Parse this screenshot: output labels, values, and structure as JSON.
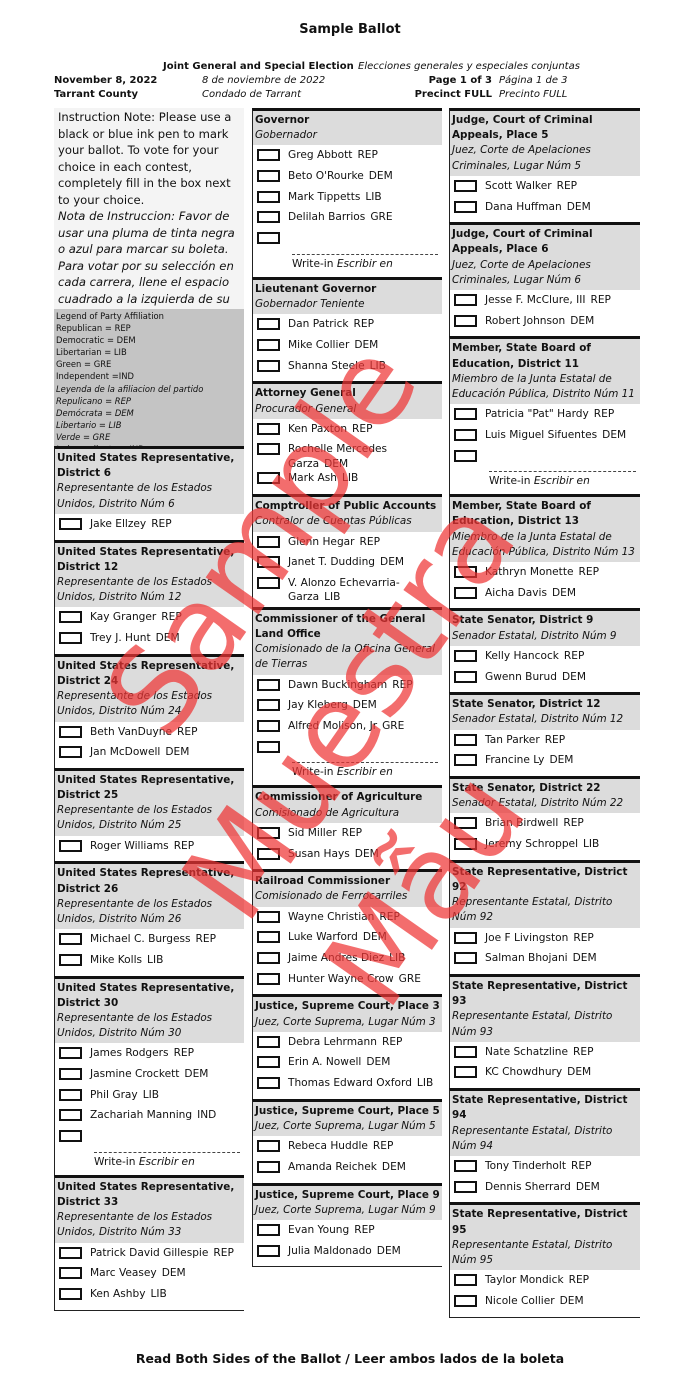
{
  "header": {
    "title": "Sample Ballot",
    "election_en": "Joint General and Special Election",
    "election_es": "Elecciones generales y especiales conjuntas",
    "date_en": "November 8, 2022",
    "date_es": "8 de noviembre de 2022",
    "county_en": "Tarrant County",
    "county_es": "Condado de Tarrant",
    "page_en": "Page 1 of 3",
    "page_es": "Página 1 de 3",
    "precinct_en": "Precinct FULL",
    "precinct_es": "Precinto FULL"
  },
  "instructions": {
    "en": "Instruction Note: Please use a black or blue ink pen to mark your ballot. To vote for your choice in each contest, completely fill in the box next to your choice.",
    "es": "Nota de Instruccion: Favor de usar una pluma de tinta negra o azul para marcar su boleta. Para votar por su selección en cada carrera, llene el espacio cuadrado a la izquierda de su selección."
  },
  "legend": {
    "en_title": "Legend of Party Affiliation",
    "en_items": [
      "Republican = REP",
      "Democratic = DEM",
      "Libertarian = LIB",
      "Green = GRE",
      "Independent =IND"
    ],
    "es_title": "Leyenda de la afiliacion del partido",
    "es_items": [
      "Repulicano = REP",
      "Demócrata = DEM",
      "Libertario = LIB",
      "Verde = GRE",
      "Independiente = IND"
    ]
  },
  "writein_label": {
    "en": "Write-in",
    "es": "Escribir en"
  },
  "columns": [
    [
      {
        "en": "United States Representative, District 6",
        "es": "Representante de los Estados Unidos, Distrito Núm 6",
        "candidates": [
          [
            "Jake Ellzey",
            "REP"
          ]
        ],
        "writein": false
      },
      {
        "en": "United States Representative, District 12",
        "es": "Representante de los Estados Unidos, Distrito Núm 12",
        "candidates": [
          [
            "Kay Granger",
            "REP"
          ],
          [
            "Trey J. Hunt",
            "DEM"
          ]
        ],
        "writein": false
      },
      {
        "en": "United States Representative, District 24",
        "es": "Representante de los Estados Unidos, Distrito Núm 24",
        "candidates": [
          [
            "Beth VanDuyne",
            "REP"
          ],
          [
            "Jan McDowell",
            "DEM"
          ]
        ],
        "writein": false
      },
      {
        "en": "United States Representative, District 25",
        "es": "Representante de los Estados Unidos, Distrito Núm 25",
        "candidates": [
          [
            "Roger Williams",
            "REP"
          ]
        ],
        "writein": false
      },
      {
        "en": "United States Representative, District 26",
        "es": "Representante de los Estados Unidos, Distrito Núm 26",
        "candidates": [
          [
            "Michael C. Burgess",
            "REP"
          ],
          [
            "Mike Kolls",
            "LIB"
          ]
        ],
        "writein": false
      },
      {
        "en": "United States Representative, District 30",
        "es": "Representante de los Estados Unidos, Distrito Núm 30",
        "candidates": [
          [
            "James Rodgers",
            "REP"
          ],
          [
            "Jasmine Crockett",
            "DEM"
          ],
          [
            "Phil Gray",
            "LIB"
          ],
          [
            "Zachariah Manning",
            "IND"
          ]
        ],
        "writein": true
      },
      {
        "en": "United States Representative, District 33",
        "es": "Representante de los Estados Unidos, Distrito Núm 33",
        "candidates": [
          [
            "Patrick David Gillespie",
            "REP"
          ],
          [
            "Marc Veasey",
            "DEM"
          ],
          [
            "Ken Ashby",
            "LIB"
          ]
        ],
        "writein": false
      }
    ],
    [
      {
        "en": "Governor",
        "es": "Gobernador",
        "candidates": [
          [
            "Greg Abbott",
            "REP"
          ],
          [
            "Beto O'Rourke",
            "DEM"
          ],
          [
            "Mark Tippetts",
            "LIB"
          ],
          [
            "Delilah Barrios",
            "GRE"
          ]
        ],
        "writein": true
      },
      {
        "en": "Lieutenant Governor",
        "es": "Gobernador Teniente",
        "candidates": [
          [
            "Dan Patrick",
            "REP"
          ],
          [
            "Mike Collier",
            "DEM"
          ],
          [
            "Shanna Steele",
            "LIB"
          ]
        ],
        "writein": false
      },
      {
        "en": "Attorney General",
        "es": "Procurador General",
        "candidates": [
          [
            "Ken Paxton",
            "REP"
          ],
          [
            "Rochelle Mercedes Garza",
            "DEM"
          ],
          [
            "Mark Ash",
            "LIB"
          ]
        ],
        "writein": false
      },
      {
        "en": "Comptroller of Public Accounts",
        "es": "Contralor de Cuentas Públicas",
        "candidates": [
          [
            "Glenn Hegar",
            "REP"
          ],
          [
            "Janet T. Dudding",
            "DEM"
          ],
          [
            "V. Alonzo Echevarria-Garza",
            "LIB"
          ]
        ],
        "writein": false
      },
      {
        "en": "Commissioner of the General Land Office",
        "es": "Comisionado de la Oficina General de Tierras",
        "candidates": [
          [
            "Dawn Buckingham",
            "REP"
          ],
          [
            "Jay Kleberg",
            "DEM"
          ],
          [
            "Alfred Molison, Jr",
            "GRE"
          ]
        ],
        "writein": true
      },
      {
        "en": "Commissioner of Agriculture",
        "es": "Comisionado de Agricultura",
        "candidates": [
          [
            "Sid Miller",
            "REP"
          ],
          [
            "Susan Hays",
            "DEM"
          ]
        ],
        "writein": false
      },
      {
        "en": "Railroad Commissioner",
        "es": "Comisionado de Ferrocarriles",
        "candidates": [
          [
            "Wayne Christian",
            "REP"
          ],
          [
            "Luke Warford",
            "DEM"
          ],
          [
            "Jaime Andres Diez",
            "LIB"
          ],
          [
            "Hunter Wayne Crow",
            "GRE"
          ]
        ],
        "writein": false
      },
      {
        "en": "Justice, Supreme Court, Place 3",
        "es": "Juez, Corte Suprema, Lugar Núm 3",
        "candidates": [
          [
            "Debra Lehrmann",
            "REP"
          ],
          [
            "Erin A. Nowell",
            "DEM"
          ],
          [
            "Thomas Edward Oxford",
            "LIB"
          ]
        ],
        "writein": false
      },
      {
        "en": "Justice, Supreme Court, Place 5",
        "es": "Juez, Corte Suprema, Lugar Núm 5",
        "candidates": [
          [
            "Rebeca Huddle",
            "REP"
          ],
          [
            "Amanda Reichek",
            "DEM"
          ]
        ],
        "writein": false
      },
      {
        "en": "Justice, Supreme Court, Place 9",
        "es": "Juez, Corte Suprema, Lugar Núm 9",
        "candidates": [
          [
            "Evan Young",
            "REP"
          ],
          [
            "Julia Maldonado",
            "DEM"
          ]
        ],
        "writein": false
      }
    ],
    [
      {
        "en": "Judge, Court of Criminal Appeals, Place 5",
        "es": "Juez, Corte de Apelaciones Criminales, Lugar Núm 5",
        "candidates": [
          [
            "Scott Walker",
            "REP"
          ],
          [
            "Dana Huffman",
            "DEM"
          ]
        ],
        "writein": false
      },
      {
        "en": "Judge, Court of Criminal Appeals, Place 6",
        "es": "Juez, Corte de Apelaciones Criminales, Lugar Núm 6",
        "candidates": [
          [
            "Jesse F. McClure, III",
            "REP"
          ],
          [
            "Robert Johnson",
            "DEM"
          ]
        ],
        "writein": false
      },
      {
        "en": "Member, State Board of Education, District 11",
        "es": "Miembro de la Junta Estatal de Educación Pública, Distrito Núm 11",
        "candidates": [
          [
            "Patricia \"Pat\" Hardy",
            "REP"
          ],
          [
            "Luis Miguel Sifuentes",
            "DEM"
          ]
        ],
        "writein": true
      },
      {
        "en": "Member, State Board of Education, District 13",
        "es": "Miembro de la Junta Estatal de Educación Pública, Distrito Núm 13",
        "candidates": [
          [
            "Kathryn Monette",
            "REP"
          ],
          [
            "Aicha Davis",
            "DEM"
          ]
        ],
        "writein": false
      },
      {
        "en": "State Senator, District 9",
        "es": "Senador Estatal, Distrito Núm 9",
        "candidates": [
          [
            "Kelly Hancock",
            "REP"
          ],
          [
            "Gwenn Burud",
            "DEM"
          ]
        ],
        "writein": false
      },
      {
        "en": "State Senator, District 12",
        "es": "Senador Estatal, Distrito Núm 12",
        "candidates": [
          [
            "Tan Parker",
            "REP"
          ],
          [
            "Francine Ly",
            "DEM"
          ]
        ],
        "writein": false
      },
      {
        "en": "State Senator, District 22",
        "es": "Senador Estatal, Distrito Núm 22",
        "candidates": [
          [
            "Brian Birdwell",
            "REP"
          ],
          [
            "Jeremy Schroppel",
            "LIB"
          ]
        ],
        "writein": false
      },
      {
        "en": "State Representative, District 92",
        "es": "Representante Estatal, Distrito Núm 92",
        "candidates": [
          [
            "Joe F Livingston",
            "REP"
          ],
          [
            "Salman Bhojani",
            "DEM"
          ]
        ],
        "writein": false
      },
      {
        "en": "State Representative, District 93",
        "es": "Representante Estatal, Distrito Núm 93",
        "candidates": [
          [
            "Nate Schatzline",
            "REP"
          ],
          [
            "KC Chowdhury",
            "DEM"
          ]
        ],
        "writein": false
      },
      {
        "en": "State Representative, District 94",
        "es": "Representante Estatal, Distrito Núm 94",
        "candidates": [
          [
            "Tony Tinderholt",
            "REP"
          ],
          [
            "Dennis Sherrard",
            "DEM"
          ]
        ],
        "writein": false
      },
      {
        "en": "State Representative, District 95",
        "es": "Representante Estatal, Distrito Núm 95",
        "candidates": [
          [
            "Taylor Mondick",
            "REP"
          ],
          [
            "Nicole Collier",
            "DEM"
          ]
        ],
        "writein": false
      }
    ]
  ],
  "watermark": {
    "words": [
      "Sample",
      "Muestra",
      "Mẫu"
    ],
    "color": "#ee3434"
  },
  "footer": "Read Both Sides of the Ballot / Leer ambos lados de la boleta"
}
